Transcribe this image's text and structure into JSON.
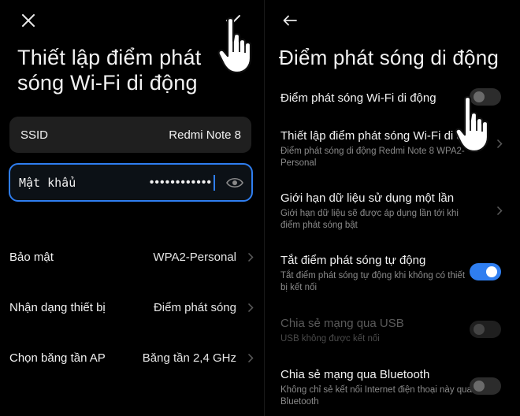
{
  "left": {
    "title_line1": "Thiết lập điểm phát",
    "title_line2": "sóng Wi-Fi di động",
    "ssid": {
      "label": "SSID",
      "value": "Redmi Note 8"
    },
    "password": {
      "label": "Mật khẩu",
      "masked": "••••••••••••"
    },
    "rows": [
      {
        "label": "Bảo mật",
        "value": "WPA2-Personal"
      },
      {
        "label": "Nhận dạng thiết bị",
        "value": "Điểm phát sóng"
      },
      {
        "label": "Chọn băng tần AP",
        "value": "Băng tần 2,4 GHz"
      }
    ],
    "icons": {
      "close": "close-icon",
      "confirm": "checkmark-icon",
      "eye": "eye-icon",
      "hand": "pointing-hand-icon"
    }
  },
  "right": {
    "title": "Điểm phát sóng di động",
    "items": [
      {
        "title": "Điểm phát sóng Wi-Fi di động",
        "subtitle": "",
        "toggle": "off"
      },
      {
        "title": "Thiết lập điểm phát sóng Wi-Fi di động",
        "subtitle": "Điểm phát sóng di động Redmi Note 8 WPA2-Personal",
        "chevron": true
      },
      {
        "title": "Giới hạn dữ liệu sử dụng một lần",
        "subtitle": "Giới hạn dữ liệu sẽ được áp dụng lần tới khi điểm phát sóng bật",
        "chevron": true
      },
      {
        "title": "Tắt điểm phát sóng tự động",
        "subtitle": "Tắt điểm phát sóng tự động khi không có thiết bị kết nối",
        "toggle": "on"
      },
      {
        "title": "Chia sẻ mạng qua USB",
        "subtitle": "USB không được kết nối",
        "toggle": "disabled"
      },
      {
        "title": "Chia sẻ mạng qua Bluetooth",
        "subtitle": "Không chỉ sẻ kết nối Internet điện thoại này qua Bluetooth",
        "toggle": "off"
      }
    ],
    "icons": {
      "back": "back-arrow-icon",
      "hand": "pointing-hand-icon"
    }
  },
  "colors": {
    "accent": "#2f7ef0",
    "background": "#000000",
    "card": "#1f1f1f"
  }
}
